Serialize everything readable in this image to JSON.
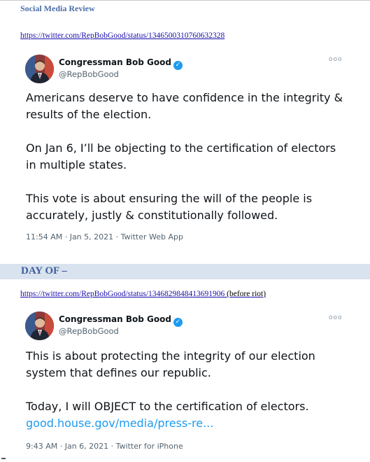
{
  "doc_header": "Social Media Review",
  "section_day_of": "DAY OF –",
  "tweets": [
    {
      "url": "https://twitter.com/RepBobGood/status/1346500310760632328",
      "url_note": "",
      "author_name": "Congressman Bob Good",
      "author_handle": "@RepBobGood",
      "verified_icon": "verified-badge-icon",
      "more_icon": "more-options-icon",
      "paragraphs": [
        "Americans deserve to have confidence in the integrity & results of the election.",
        "On Jan 6, I’ll be objecting to the certification of electors in multiple states.",
        "This vote is about ensuring the will of the people is accurately, justly & constitutionally followed."
      ],
      "meta": "11:54 AM · Jan 5, 2021 · Twitter Web App"
    },
    {
      "url": "https://twitter.com/RepBobGood/status/1346829848413691906",
      "url_note": "(before riot)",
      "author_name": "Congressman Bob Good",
      "author_handle": "@RepBobGood",
      "verified_icon": "verified-badge-icon",
      "more_icon": "more-options-icon",
      "paragraphs": [
        "This is about protecting the integrity of our election system that defines our republic.",
        "Today, I will OBJECT to the certification of electors."
      ],
      "link_text": "good.house.gov/media/press-re...",
      "meta": "9:43 AM · Jan 6, 2021 · Twitter for iPhone"
    }
  ],
  "colors": {
    "header_blue": "#4a6ea8",
    "section_bar": "#d9e2ef",
    "twitter_blue": "#1d9bf0",
    "link": "#1a0dab"
  }
}
